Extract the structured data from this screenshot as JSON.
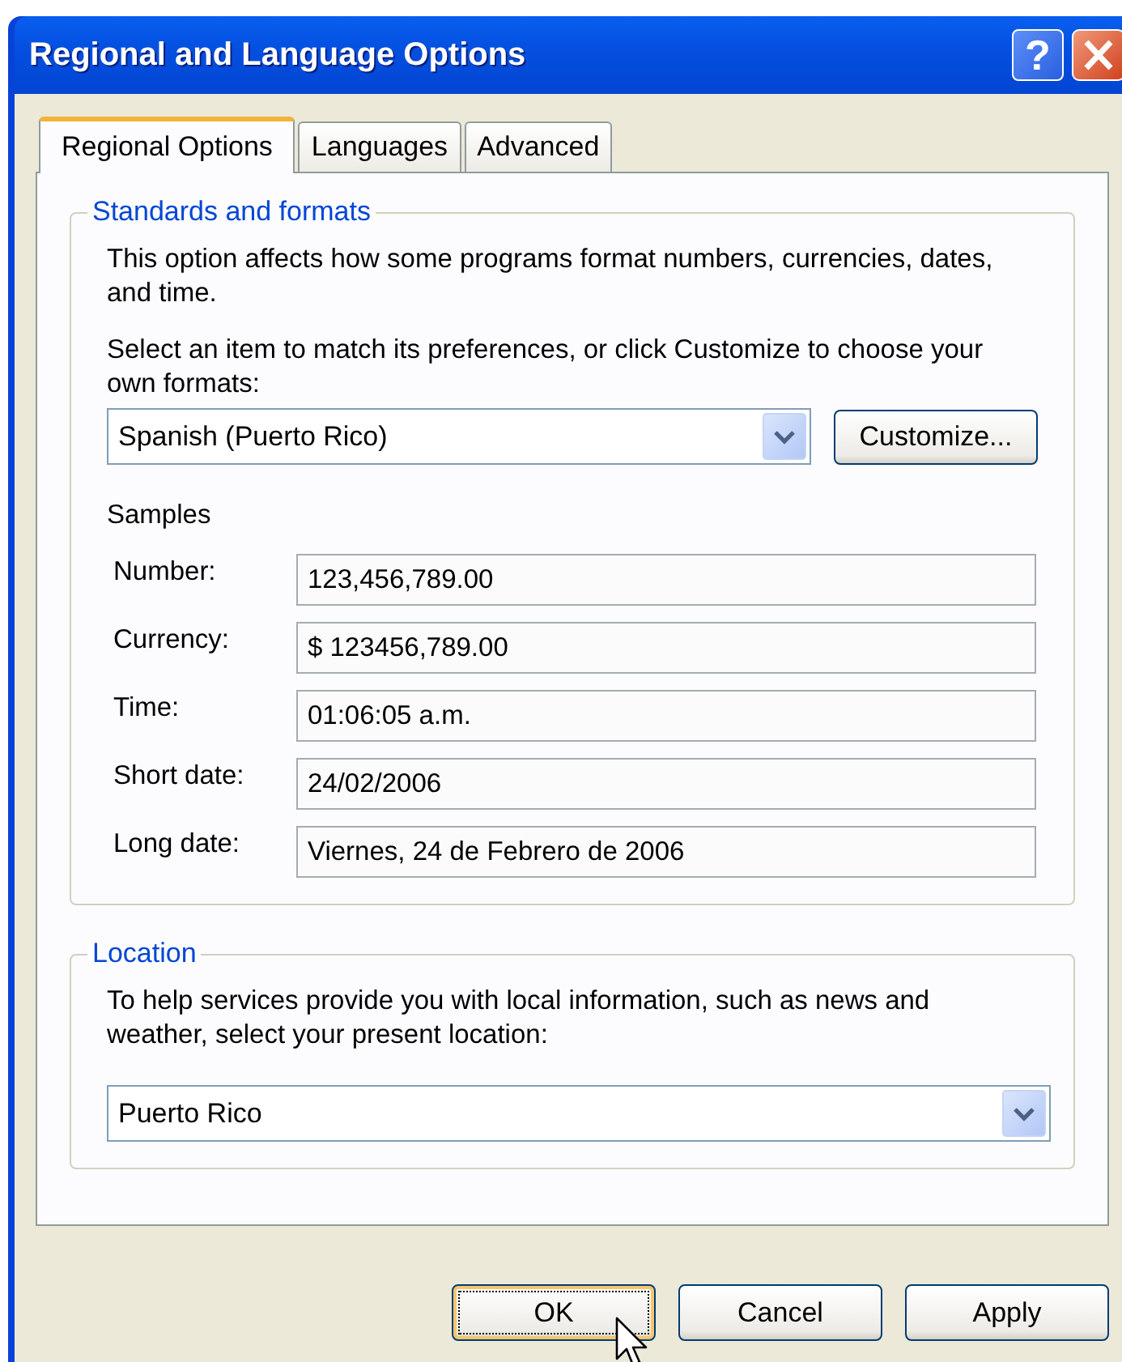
{
  "window": {
    "title": "Regional and Language Options",
    "help_label": "?"
  },
  "tabs": [
    {
      "label": "Regional Options",
      "selected": true
    },
    {
      "label": "Languages",
      "selected": false
    },
    {
      "label": "Advanced",
      "selected": false
    }
  ],
  "standards": {
    "legend": "Standards and formats",
    "description": "This option affects how some programs format numbers, currencies, dates, and time.",
    "instruction": "Select an item to match its preferences, or click Customize to choose your own formats:",
    "format": "Spanish (Puerto Rico)",
    "customize_button": "Customize...",
    "samples_label": "Samples",
    "samples": [
      {
        "label": "Number:",
        "value": "123,456,789.00"
      },
      {
        "label": "Currency:",
        "value": "$ 123456,789.00"
      },
      {
        "label": "Time:",
        "value": "01:06:05 a.m."
      },
      {
        "label": "Short date:",
        "value": "24/02/2006"
      },
      {
        "label": "Long date:",
        "value": "Viernes, 24 de Febrero de 2006"
      }
    ]
  },
  "location": {
    "legend": "Location",
    "description": "To help services provide you with local information, such as news and weather, select your present location:",
    "value": "Puerto Rico"
  },
  "buttons": [
    {
      "label": "OK",
      "focused": true
    },
    {
      "label": "Cancel",
      "focused": false
    },
    {
      "label": "Apply",
      "focused": false
    }
  ]
}
